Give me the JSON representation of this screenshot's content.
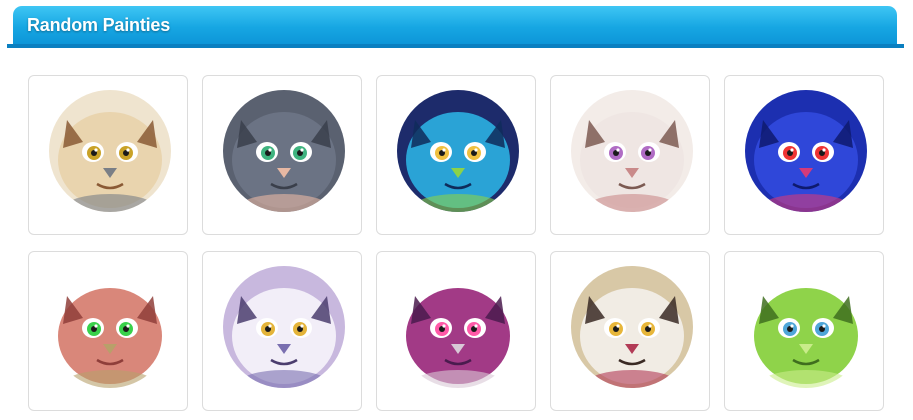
{
  "section": {
    "title": "Random Painties"
  },
  "painties": [
    {
      "subject": "owl",
      "colors": {
        "bg": "#efe4cf",
        "main": "#e9d4ae",
        "dark": "#8a5a35",
        "eye": "#c9a227",
        "accent": "#7a7f86"
      }
    },
    {
      "subject": "gray-cat",
      "colors": {
        "bg": "#5a6170",
        "main": "#6b7384",
        "dark": "#3a3f4b",
        "eye": "#3fb37f",
        "accent": "#e7b8a3"
      }
    },
    {
      "subject": "rainbow-fox",
      "colors": {
        "bg": "#1d2b6b",
        "main": "#2aa3d6",
        "dark": "#0f2b5a",
        "eye": "#f0c040",
        "accent": "#8bd24a"
      }
    },
    {
      "subject": "white-tiger",
      "colors": {
        "bg": "#f3ece8",
        "main": "#efe6e3",
        "dark": "#7c5a52",
        "eye": "#b06cc4",
        "accent": "#c98a8a"
      }
    },
    {
      "subject": "blue-monster",
      "colors": {
        "bg": "#1c2fb0",
        "main": "#2f47d9",
        "dark": "#0e1a6e",
        "eye": "#e33",
        "accent": "#d43a7a"
      }
    },
    {
      "subject": "pink-lizard",
      "colors": {
        "bg": "#ffffff",
        "main": "#d9877a",
        "dark": "#8f3e3a",
        "eye": "#39d14b",
        "accent": "#b8a06a"
      }
    },
    {
      "subject": "snow-leopard",
      "colors": {
        "bg": "#c8b8de",
        "main": "#f2eef8",
        "dark": "#4b3d6e",
        "eye": "#e4b43a",
        "accent": "#7a6fb0"
      }
    },
    {
      "subject": "purple-dragon",
      "colors": {
        "bg": "#ffffff",
        "main": "#a23a86",
        "dark": "#4a1b4e",
        "eye": "#ff5aa8",
        "accent": "#d8c8d6"
      }
    },
    {
      "subject": "skull-flower",
      "colors": {
        "bg": "#d8c8a6",
        "main": "#f1ece4",
        "dark": "#3a2a24",
        "eye": "#e7b63a",
        "accent": "#b23b56"
      }
    },
    {
      "subject": "green-dragon",
      "colors": {
        "bg": "#ffffff",
        "main": "#8fd34a",
        "dark": "#3f6e1e",
        "eye": "#4fa6d8",
        "accent": "#c9ec8a"
      }
    }
  ]
}
